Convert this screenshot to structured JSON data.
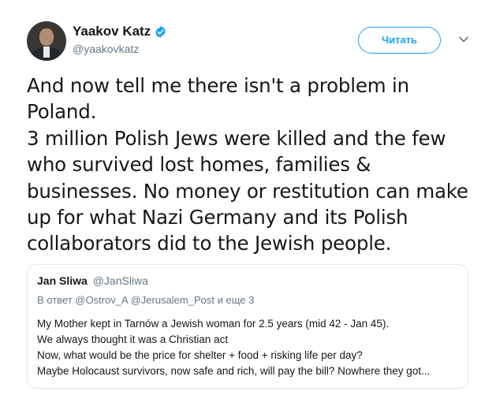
{
  "author": {
    "display_name": "Yaakov Katz",
    "handle": "@yaakovkatz",
    "verified": true,
    "avatar_icon": "profile-photo",
    "verified_icon": "verified-badge-icon"
  },
  "actions": {
    "follow_label": "Читать",
    "more_icon": "chevron-down-icon"
  },
  "tweet": {
    "lines": [
      "And now tell me there isn't a problem in",
      "Poland.",
      "3 million Polish Jews were killed and the few",
      "who survived lost homes, families &",
      "businesses. No money or restitution can make",
      "up for what Nazi Germany and its Polish",
      "collaborators did to the Jewish people."
    ]
  },
  "quoted": {
    "display_name": "Jan Sliwa",
    "handle": "@JanSliwa",
    "reply_to": "В ответ @Ostrov_A @Jerusalem_Post и еще 3",
    "lines": [
      "My Mother kept in Tarnów a Jewish woman for 2.5 years (mid 42 - Jan 45).",
      "We always thought it was a Christian act",
      "Now, what would be the price for shelter + food + risking life per day?",
      "Maybe Holocaust survivors, now safe and rich, will pay the bill? Nowhere they got..."
    ]
  },
  "colors": {
    "accent": "#1da1f2",
    "text": "#14171a",
    "secondary": "#657786",
    "border": "#e1e8ed"
  }
}
